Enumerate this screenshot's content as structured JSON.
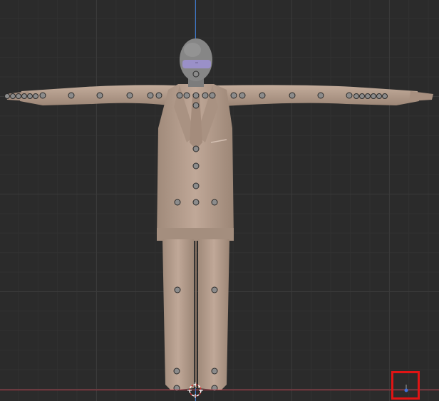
{
  "viewport": {
    "mode": "front-orthographic",
    "grid": true
  },
  "colors": {
    "background": "#2b2b2b",
    "grid_major": "#3a3a3a",
    "grid_minor": "#313131",
    "axis_z": "#3e7bd0",
    "axis_x": "#c23a4a",
    "suit": "#b8a090",
    "head": "#8a8a8a",
    "glasses": "#9a90c8",
    "bone_joint": "#8c8c8c",
    "highlight": "#e01414"
  },
  "scene": {
    "object": "suited-man-mesh",
    "pose": "t-pose",
    "armature_joints_visible": true,
    "selected_object_icon": "light-icon"
  }
}
